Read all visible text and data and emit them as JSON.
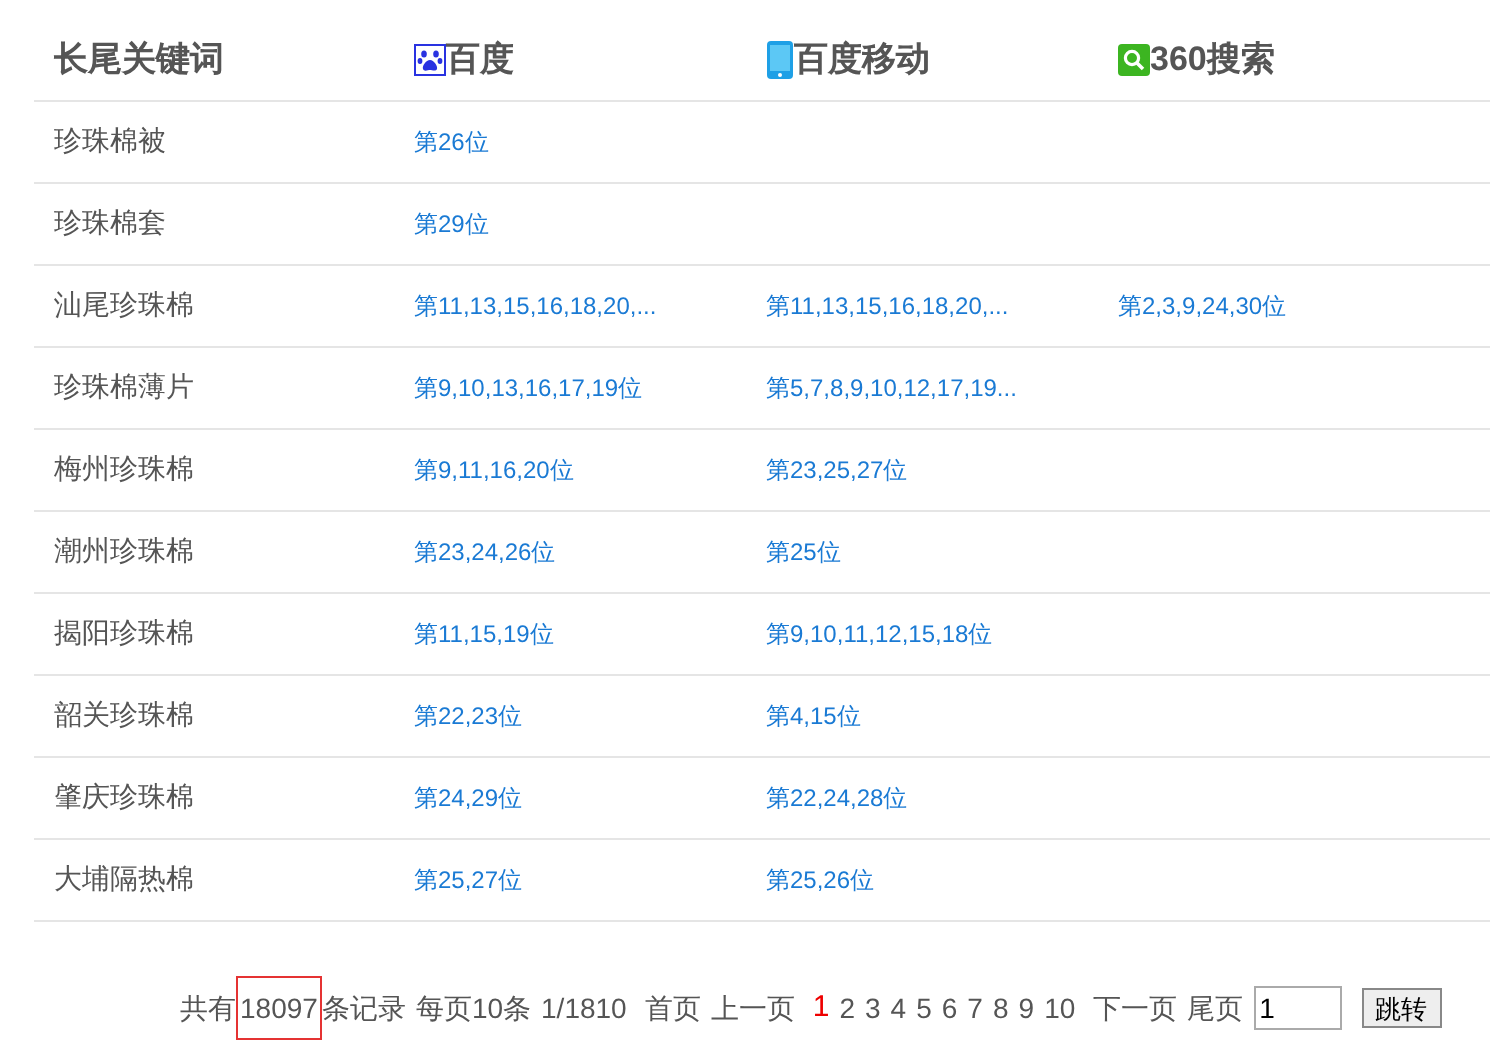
{
  "table": {
    "columns": [
      {
        "label": "长尾关键词",
        "kind": "text"
      },
      {
        "label": "百度",
        "kind": "paw"
      },
      {
        "label": "百度移动",
        "kind": "phone"
      },
      {
        "label": "360搜索",
        "kind": "search"
      }
    ],
    "rows": [
      {
        "cells": [
          "珍珠棉被",
          "第26位",
          "",
          ""
        ]
      },
      {
        "cells": [
          "珍珠棉套",
          "第29位",
          "",
          ""
        ]
      },
      {
        "cells": [
          "汕尾珍珠棉",
          "第11,13,15,16,18,20,...",
          "第11,13,15,16,18,20,...",
          "第2,3,9,24,30位"
        ]
      },
      {
        "cells": [
          "珍珠棉薄片",
          "第9,10,13,16,17,19位",
          "第5,7,8,9,10,12,17,19...",
          ""
        ]
      },
      {
        "cells": [
          "梅州珍珠棉",
          "第9,11,16,20位",
          "第23,25,27位",
          ""
        ]
      },
      {
        "cells": [
          "潮州珍珠棉",
          "第23,24,26位",
          "第25位",
          ""
        ]
      },
      {
        "cells": [
          "揭阳珍珠棉",
          "第11,15,19位",
          "第9,10,11,12,15,18位",
          ""
        ]
      },
      {
        "cells": [
          "韶关珍珠棉",
          "第22,23位",
          "第4,15位",
          ""
        ]
      },
      {
        "cells": [
          "肇庆珍珠棉",
          "第24,29位",
          "第22,24,28位",
          ""
        ]
      },
      {
        "cells": [
          "大埔隔热棉",
          "第25,27位",
          "第25,26位",
          ""
        ]
      }
    ]
  },
  "pagination": {
    "total_prefix": "共有",
    "total": "18097",
    "total_suffix": "条记录",
    "per_page": "每页10条",
    "page_of": "1/1810",
    "first": "首页",
    "prev": "上一页",
    "pages": [
      {
        "label": "1",
        "selected": true
      },
      {
        "label": "2",
        "selected": false
      },
      {
        "label": "3",
        "selected": false
      },
      {
        "label": "4",
        "selected": false
      },
      {
        "label": "5",
        "selected": false
      },
      {
        "label": "6",
        "selected": false
      },
      {
        "label": "7",
        "selected": false
      },
      {
        "label": "8",
        "selected": false
      },
      {
        "label": "9",
        "selected": false
      },
      {
        "label": "10",
        "selected": false
      }
    ],
    "next": "下一页",
    "last": "尾页",
    "jump_value": "1",
    "jump_button": "跳转"
  }
}
